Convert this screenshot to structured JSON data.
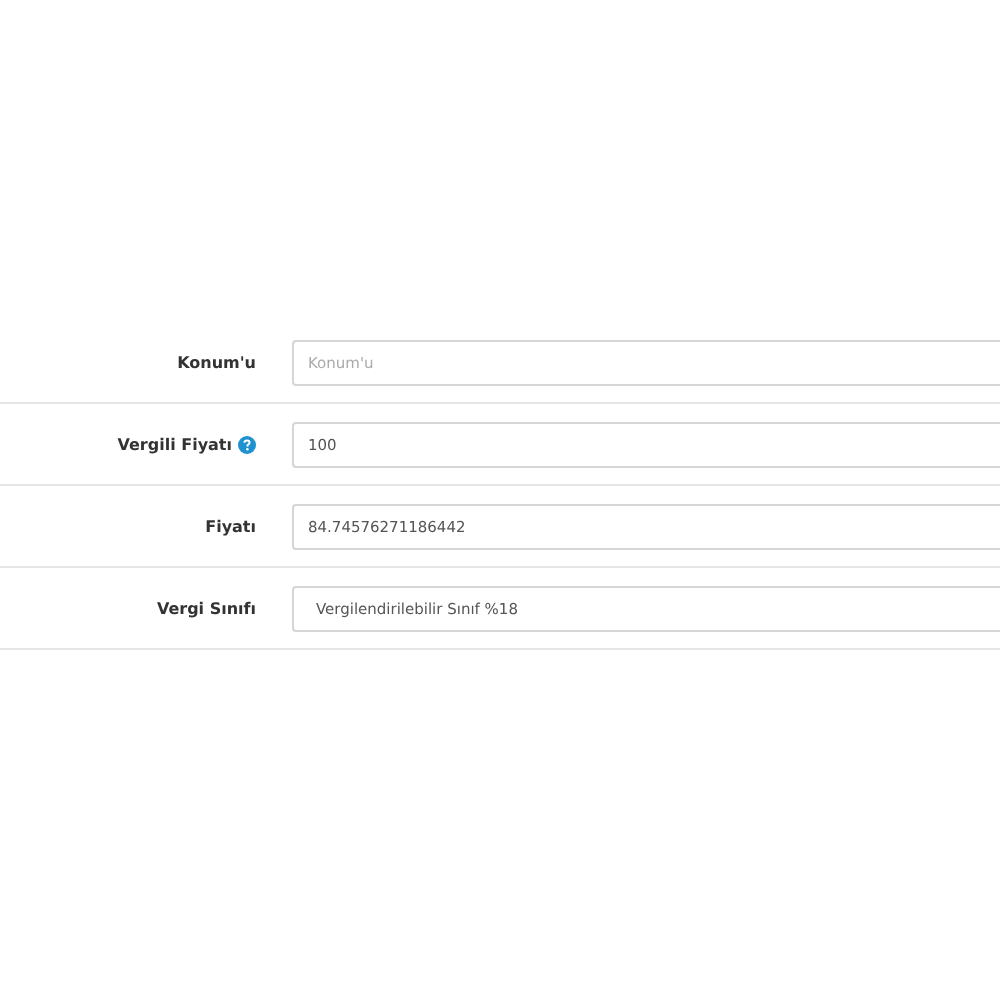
{
  "form": {
    "rows": [
      {
        "kind": "input",
        "label": "Konum'u",
        "placeholder": "Konum'u",
        "help": false
      },
      {
        "kind": "input",
        "label": "Vergili Fiyatı",
        "value": "100",
        "help": true
      },
      {
        "kind": "input",
        "label": "Fiyatı",
        "value": "84.74576271186442",
        "help": false
      },
      {
        "kind": "select",
        "label": "Vergi Sınıfı",
        "value": "Vergilendirilebilir Sınıf %18",
        "help": false
      }
    ]
  }
}
